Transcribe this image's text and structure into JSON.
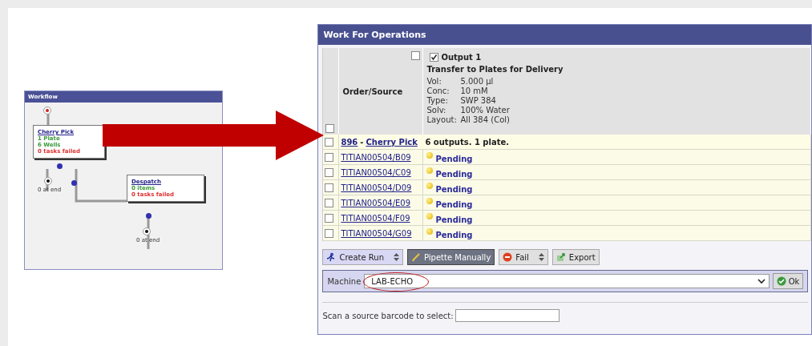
{
  "workflow": {
    "title": "Workflow",
    "nodes": [
      {
        "title": "Cherry Pick",
        "lines": [
          {
            "text": "1 Plate",
            "color": "#3a9a3a"
          },
          {
            "text": "6 Wells",
            "color": "#3a9a3a"
          },
          {
            "text": "0 tasks failed",
            "color": "#e03030"
          }
        ],
        "end_label": "0 at end"
      },
      {
        "title": "Despatch",
        "lines": [
          {
            "text": "0 items",
            "color": "#3a9a3a"
          },
          {
            "text": "0 tasks failed",
            "color": "#e03030"
          }
        ],
        "end_label": "0 at end"
      }
    ]
  },
  "panel": {
    "title": "Work For Operations",
    "header": {
      "select_all_checked": false,
      "order_checked": false,
      "column_title": "Order/Source",
      "output_checked": true,
      "output_title": "Output 1",
      "output_subtitle": "Transfer to Plates for Delivery",
      "properties": [
        {
          "label": "Vol:",
          "value": "5.000 µl"
        },
        {
          "label": "Conc:",
          "value": "10 mM"
        },
        {
          "label": "Type:",
          "value": "SWP 384"
        },
        {
          "label": "Solv:",
          "value": "100% Water"
        },
        {
          "label": "Layout:",
          "value": "All 384 (Col)"
        }
      ]
    },
    "group": {
      "checked": false,
      "order": "896",
      "separator": "-",
      "operation": "Cherry Pick",
      "summary": "6 outputs. 1 plate."
    },
    "rows": [
      {
        "checked": false,
        "source": "TITIAN00504/B09",
        "status": "Pending"
      },
      {
        "checked": false,
        "source": "TITIAN00504/C09",
        "status": "Pending"
      },
      {
        "checked": false,
        "source": "TITIAN00504/D09",
        "status": "Pending"
      },
      {
        "checked": false,
        "source": "TITIAN00504/E09",
        "status": "Pending"
      },
      {
        "checked": false,
        "source": "TITIAN00504/F09",
        "status": "Pending"
      },
      {
        "checked": false,
        "source": "TITIAN00504/G09",
        "status": "Pending"
      }
    ],
    "toolbar": [
      {
        "kind": "run",
        "label": "Create Run",
        "selected": false
      },
      {
        "kind": "pipette",
        "label": "Pipette Manually",
        "selected": true
      },
      {
        "kind": "fail",
        "label": "Fail",
        "selected": false
      },
      {
        "kind": "export",
        "label": "Export",
        "selected": false
      }
    ],
    "machine": {
      "label": "Machine",
      "value": "LAB-ECHO",
      "ok": "Ok"
    },
    "scan": {
      "label": "Scan a source barcode to select:"
    }
  }
}
